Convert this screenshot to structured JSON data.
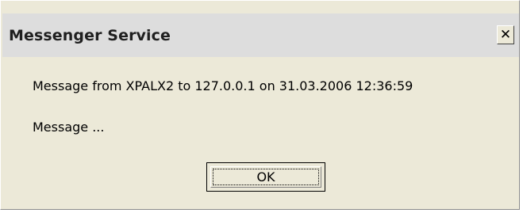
{
  "window": {
    "title": "Messenger Service",
    "close_glyph": "✕"
  },
  "content": {
    "header_line": "Message from XPALX2 to 127.0.0.1 on 31.03.2006 12:36:59",
    "message_body": "Message ..."
  },
  "buttons": {
    "ok_label": "OK"
  },
  "icons": {
    "close": "close-icon"
  },
  "colors": {
    "dialog_background": "#ece9d8",
    "titlebar_background": "#dddddd",
    "text": "#000000"
  }
}
